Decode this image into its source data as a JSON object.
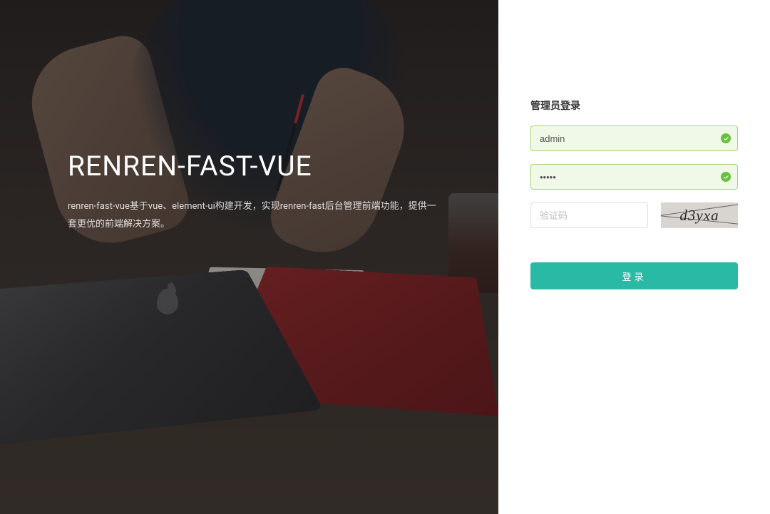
{
  "brand": {
    "title": "RENREN-FAST-VUE",
    "description": "renren-fast-vue基于vue、element-ui构建开发，实现renren-fast后台管理前端功能，提供一套更优的前端解决方案。"
  },
  "login": {
    "title": "管理员登录",
    "username_value": "admin",
    "password_value": "•••••",
    "captcha_placeholder": "验证码",
    "captcha_text": "d3yxa",
    "submit_label": "登录"
  },
  "colors": {
    "input_valid_bg": "#f0f9e8",
    "input_valid_border": "#a4d66b",
    "success_icon": "#67c23a",
    "primary_button": "#2ab9a5"
  }
}
